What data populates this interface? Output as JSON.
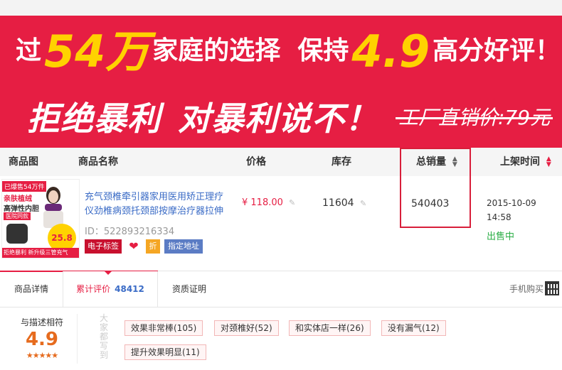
{
  "banner": {
    "line1_pre": "过",
    "line1_num": "54万",
    "line1_mid": "家庭的选择",
    "line1_pre2": "保持",
    "line1_score": "4.9",
    "line1_post": "高分好评！",
    "line2_slogan_a": "拒绝暴利",
    "line2_slogan_b": "对暴利说不！",
    "line2_strike": "工厂直销价:79元"
  },
  "table": {
    "headers": {
      "image": "商品图",
      "name": "商品名称",
      "price": "价格",
      "stock": "库存",
      "sales": "总销量",
      "date": "上架时间"
    }
  },
  "product": {
    "thumb": {
      "tag1": "已爆售54万件",
      "tag2": "亲肤植绒",
      "tag3": "高弹性内胆",
      "tag4": "医院同款",
      "price_badge": "25.8",
      "bottom": "拒绝暴利 新升级三管充气"
    },
    "name": "充气颈椎牵引器家用医用矫正理疗仪劲椎病颈托颈部按摩治疗器拉伸",
    "id_text": "ID：522893216334",
    "badges": {
      "e_label": "电子标签",
      "heart": "❤",
      "discount": "折",
      "address": "指定地址"
    },
    "price": "¥ 118.00",
    "stock": "11604",
    "sales": "540403",
    "date": "2015-10-09 14:58",
    "status": "出售中"
  },
  "tabs": {
    "items": [
      {
        "label": "商品详情"
      },
      {
        "label": "累计评价",
        "count": "48412"
      },
      {
        "label": "资质证明"
      }
    ],
    "mobile": "手机购买"
  },
  "reviews": {
    "label": "与描述相符",
    "score": "4.9",
    "stars": "★★★★★",
    "caption": "大家都写到",
    "tags": [
      "效果非常棒(105)",
      "对颈椎好(52)",
      "和实体店一样(26)",
      "没有漏气(12)",
      "提升效果明显(11)"
    ]
  },
  "colors": {
    "brand_red": "#e61e43",
    "yellow": "#ffd200",
    "link_blue": "#3a6bc6",
    "green": "#2bae46",
    "orange": "#e66b1e"
  }
}
